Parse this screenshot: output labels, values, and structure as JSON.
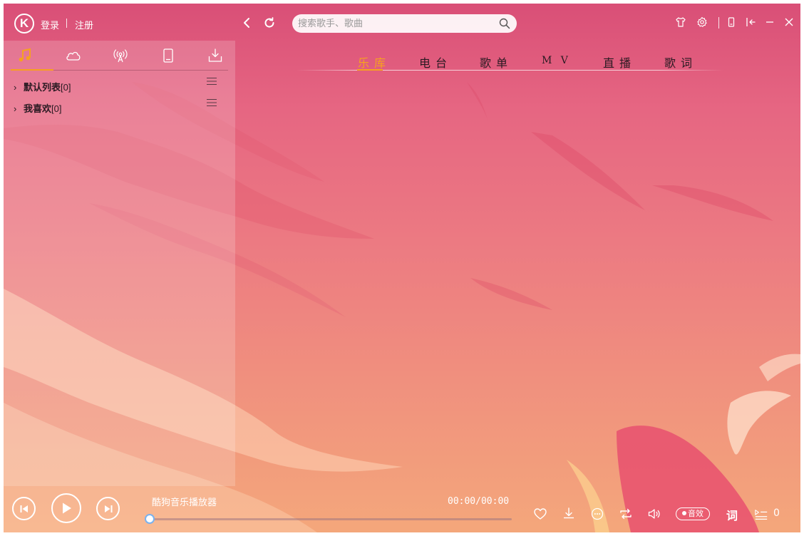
{
  "header": {
    "logo_letter": "K",
    "login_label": "登录",
    "register_label": "注册",
    "search": {
      "placeholder": "搜索歌手、歌曲",
      "value": ""
    }
  },
  "sidebar": {
    "tabs": [
      {
        "icon": "music-note-icon",
        "active": true
      },
      {
        "icon": "cloud-icon",
        "active": false
      },
      {
        "icon": "radio-broadcast-icon",
        "active": false
      },
      {
        "icon": "device-icon",
        "active": false
      },
      {
        "icon": "download-icon",
        "active": false
      }
    ],
    "playlists": [
      {
        "name": "默认列表",
        "count": "[0]"
      },
      {
        "name": "我喜欢",
        "count": "[0]"
      }
    ]
  },
  "main_tabs": [
    {
      "label": "乐库",
      "active": true
    },
    {
      "label": "电台",
      "active": false
    },
    {
      "label": "歌单",
      "active": false
    },
    {
      "label": "M V",
      "active": false
    },
    {
      "label": "直播",
      "active": false
    },
    {
      "label": "歌词",
      "active": false
    }
  ],
  "player": {
    "title": "酷狗音乐播放器",
    "time": "00:00/00:00",
    "progress": 0,
    "sound_effect_label": "音效",
    "lyrics_label": "词",
    "queue_count": "0"
  },
  "colors": {
    "accent": "#f6a21f",
    "bg_top": "#d94f77",
    "bg_bottom": "#f4a77b",
    "progress_knob": "#7ab2ee"
  }
}
